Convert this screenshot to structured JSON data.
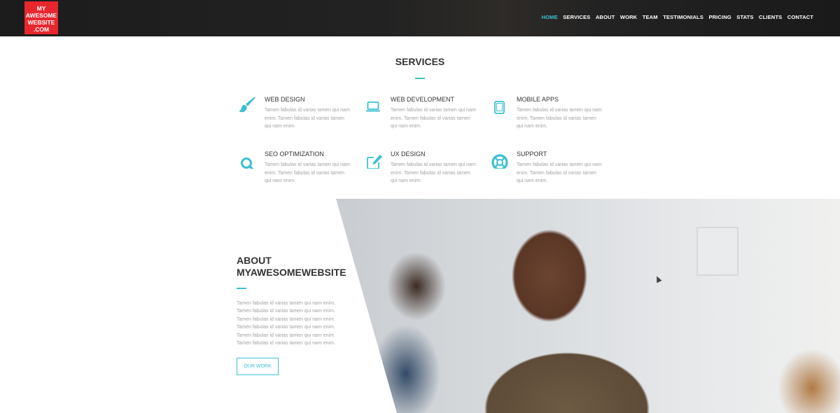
{
  "header": {
    "logo_lines": [
      "MY",
      "AWESOME",
      "WEBSITE",
      ".COM"
    ],
    "nav": [
      "HOME",
      "SERVICES",
      "ABOUT",
      "WORK",
      "TEAM",
      "TESTIMONIALS",
      "PRICING",
      "STATS",
      "CLIENTS",
      "CONTACT"
    ],
    "active": "HOME"
  },
  "services": {
    "title": "SERVICES",
    "items": [
      {
        "title": "WEB DESIGN",
        "text": "Tamen fabulas id varias tamen qui nam enim. Tamen fabulas id varias tamen qui nam enim.",
        "icon": "brush-icon"
      },
      {
        "title": "WEB DEVELOPMENT",
        "text": "Tamen fabulas id varias tamen qui nam enim. Tamen fabulas id varias tamen qui nam enim.",
        "icon": "laptop-icon"
      },
      {
        "title": "MOBILE APPS",
        "text": "Tamen fabulas id varias tamen qui nam enim. Tamen fabulas id varias tamen qui nam enim.",
        "icon": "tablet-icon"
      },
      {
        "title": "SEO OPTIMIZATION",
        "text": "Tamen fabulas id varias tamen qui nam enim. Tamen fabulas id varias tamen qui nam enim.",
        "icon": "search-icon"
      },
      {
        "title": "UX DESIGN",
        "text": "Tamen fabulas id varias tamen qui nam enim. Tamen fabulas id varias tamen qui nam enim.",
        "icon": "edit-icon"
      },
      {
        "title": "SUPPORT",
        "text": "Tamen fabulas id varias tamen qui nam enim. Tamen fabulas id varias tamen qui nam enim.",
        "icon": "lifebuoy-icon"
      }
    ]
  },
  "about": {
    "title_line1": "ABOUT",
    "title_line2": "MYAWESOMEWEBSITE",
    "text": "Tamen fabulas id varias tamen qui nam enim. Tamen fabulas id varias tamen qui nam enim. Tamen fabulas id varias tamen qui nam enim. Tamen fabulas id varias tamen qui nam enim. Tamen fabulas id varias tamen qui nam enim. Tamen fabulas id varias tamen qui nam enim.",
    "button_label": "OUR WORK"
  },
  "colors": {
    "accent": "#3cc0d0",
    "logo_bg": "#e8262e",
    "header_bg": "#1e1e1e"
  }
}
